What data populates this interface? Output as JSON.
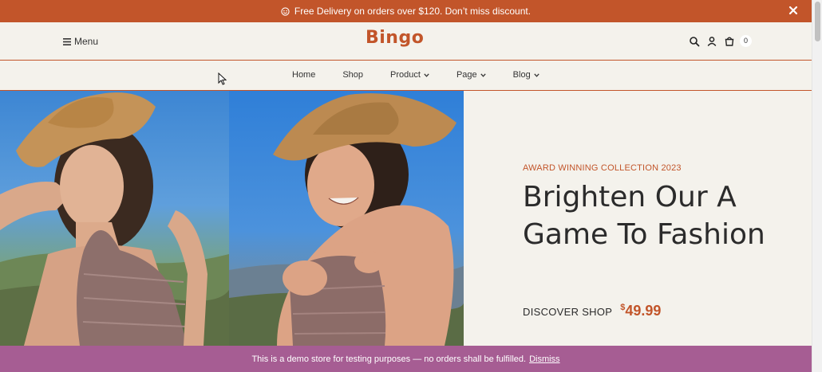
{
  "announcement": {
    "text": "Free Delivery on orders over $120. Don’t miss discount.",
    "icon": "smile-icon",
    "close_icon": "close-icon"
  },
  "header": {
    "menu_label": "Menu",
    "logo": "Bingo",
    "cart_count": "0",
    "icons": [
      "search-icon",
      "user-icon",
      "cart-icon"
    ]
  },
  "nav": {
    "items": [
      {
        "label": "Home",
        "dropdown": false
      },
      {
        "label": "Shop",
        "dropdown": false
      },
      {
        "label": "Product",
        "dropdown": true
      },
      {
        "label": "Page",
        "dropdown": true
      },
      {
        "label": "Blog",
        "dropdown": true
      }
    ]
  },
  "hero": {
    "kicker": "AWARD WINNING COLLECTION 2023",
    "headline": "Brighten Our A Game To Fashion",
    "cta_label": "DISCOVER SHOP",
    "price_currency": "$",
    "price_value": "49.99"
  },
  "demo_bar": {
    "text": "This is a demo store for testing purposes — no orders shall be fulfilled.",
    "dismiss_label": "Dismiss"
  },
  "colors": {
    "accent": "#c2552a",
    "background": "#f4f2ec",
    "demo_bar": "#a65d93"
  }
}
